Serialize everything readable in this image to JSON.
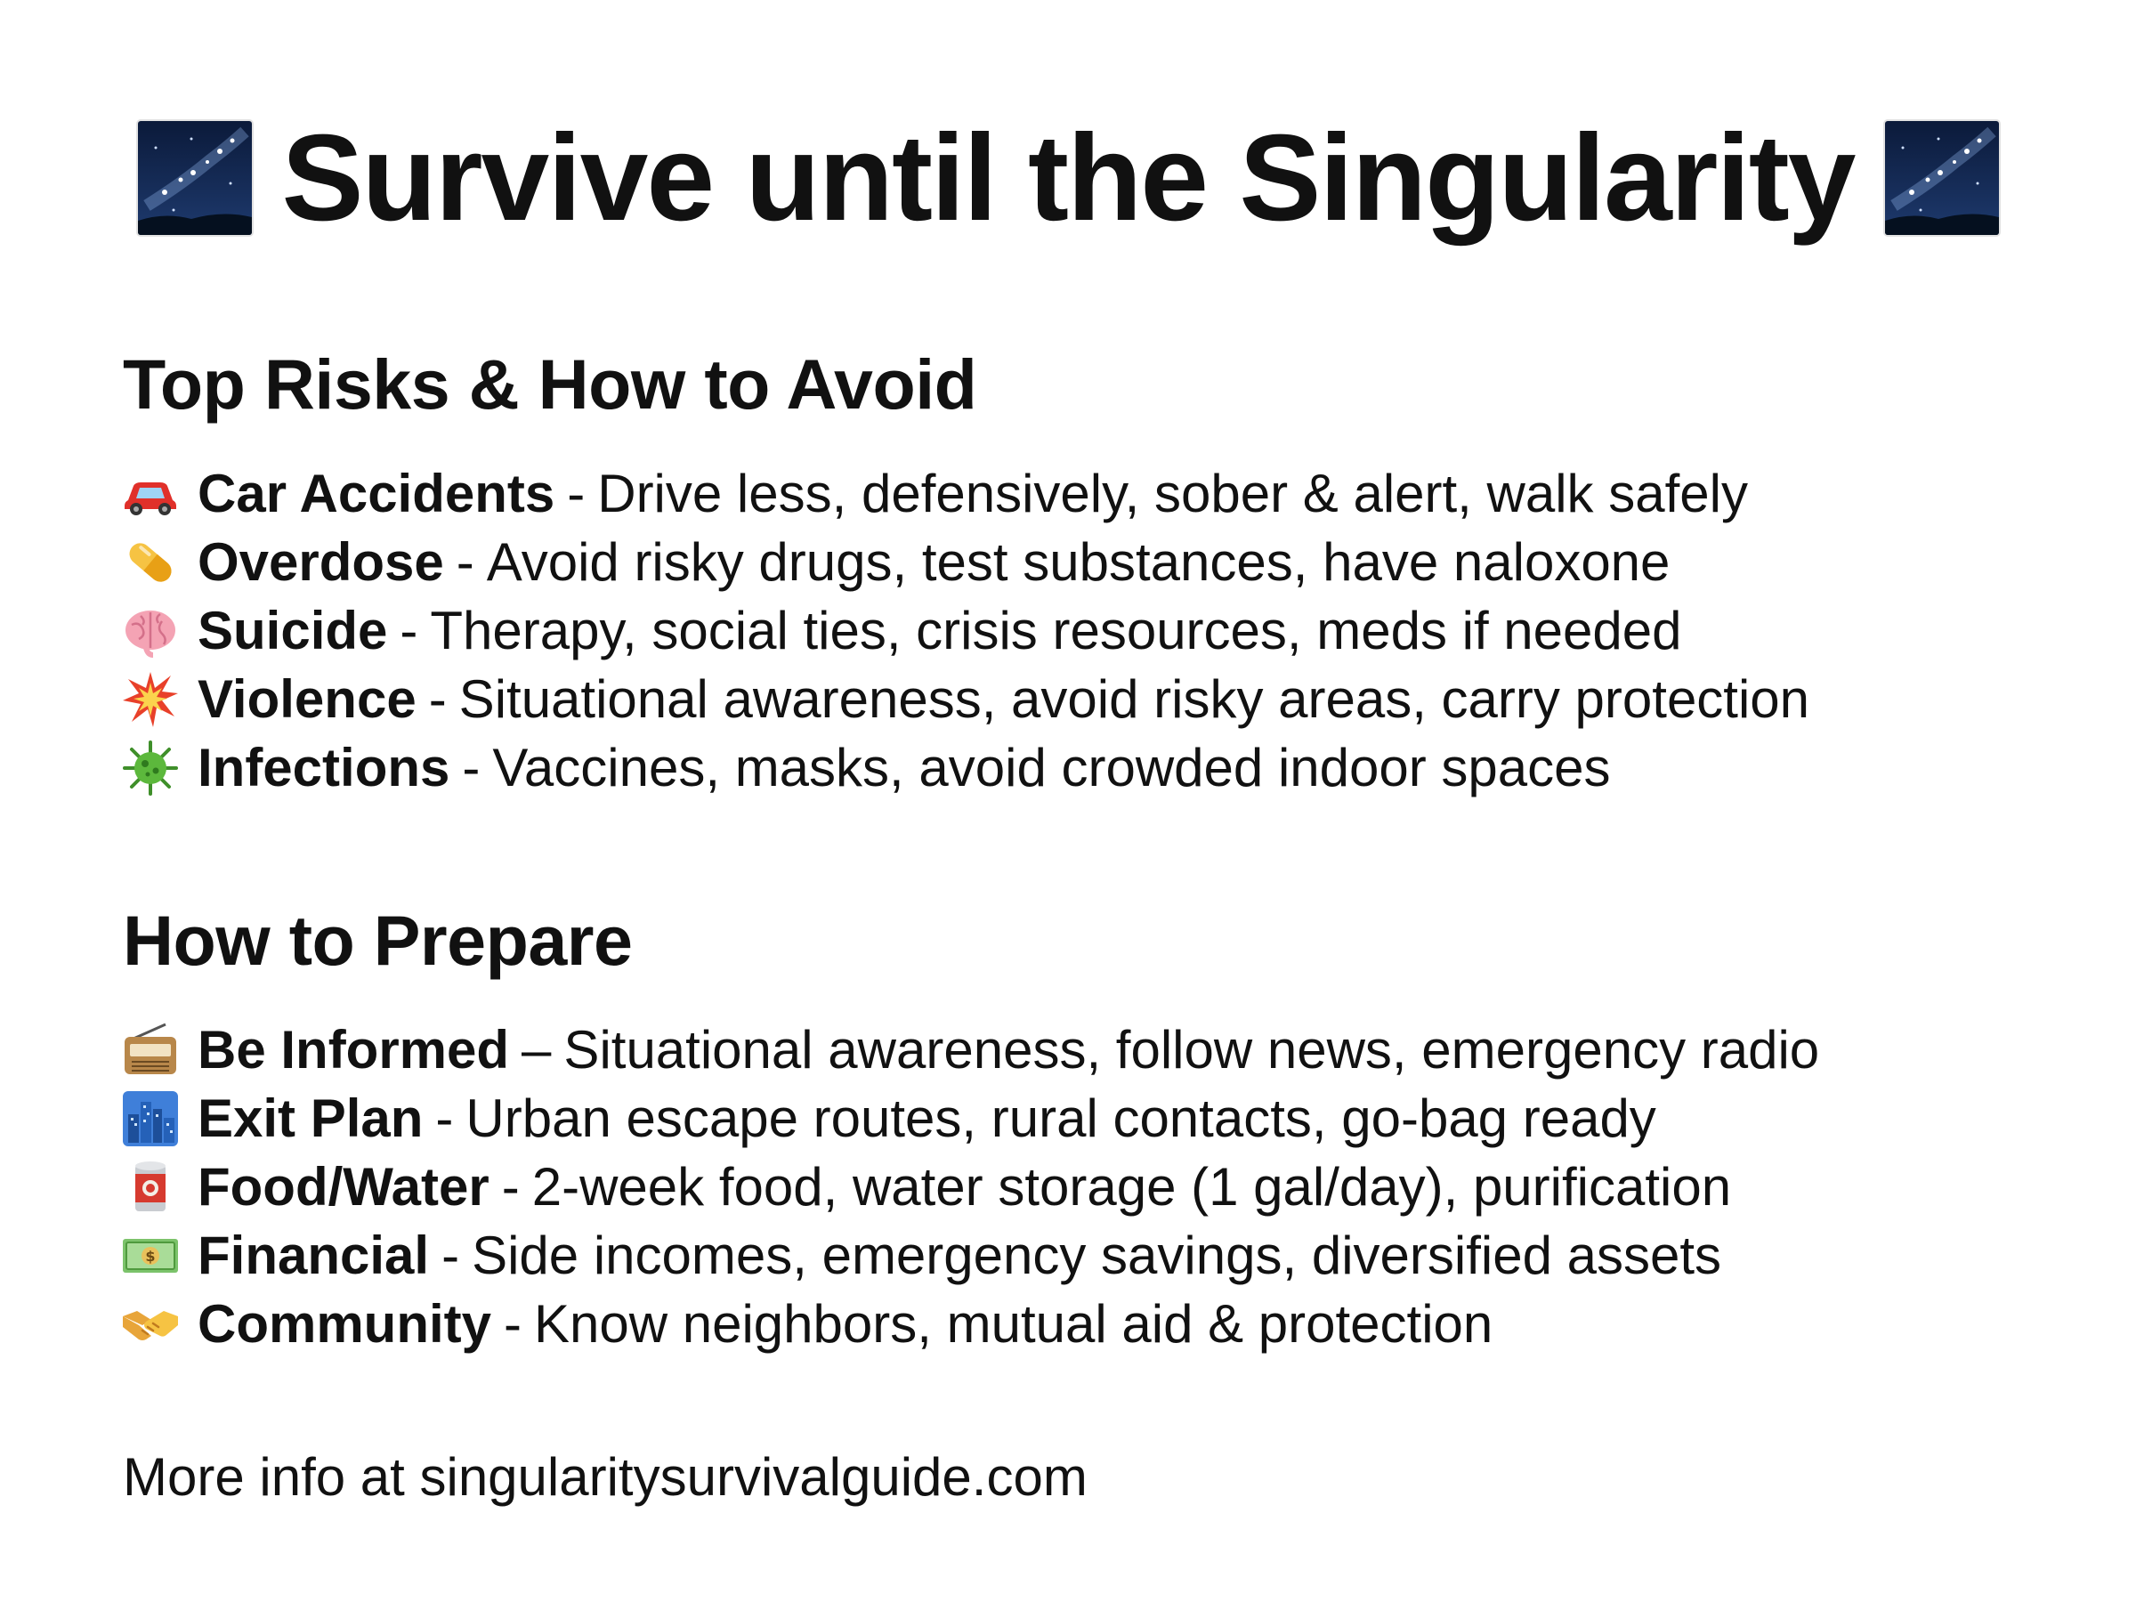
{
  "title": {
    "text": "Survive until the Singularity",
    "icon_left": "milky-way-icon",
    "icon_right": "milky-way-icon"
  },
  "risks": {
    "heading": "Top Risks & How to Avoid",
    "items": [
      {
        "icon": "car-icon",
        "name": "Car Accidents",
        "sep": "-",
        "desc": "Drive less, defensively, sober & alert, walk safely"
      },
      {
        "icon": "pill-icon",
        "name": "Overdose",
        "sep": "-",
        "desc": "Avoid risky drugs, test substances, have naloxone"
      },
      {
        "icon": "brain-icon",
        "name": "Suicide",
        "sep": "-",
        "desc": "Therapy, social ties, crisis resources, meds if needed"
      },
      {
        "icon": "collision-icon",
        "name": "Violence",
        "sep": "-",
        "desc": "Situational awareness, avoid risky areas, carry protection"
      },
      {
        "icon": "microbe-icon",
        "name": "Infections",
        "sep": "-",
        "desc": "Vaccines, masks, avoid crowded indoor spaces"
      }
    ]
  },
  "prepare": {
    "heading": "How to Prepare",
    "items": [
      {
        "icon": "radio-icon",
        "name": "Be Informed",
        "sep": "–",
        "desc": "Situational awareness, follow news, emergency radio"
      },
      {
        "icon": "cityscape-icon",
        "name": "Exit Plan",
        "sep": "-",
        "desc": "Urban escape routes, rural contacts, go-bag ready"
      },
      {
        "icon": "canned-food-icon",
        "name": "Food/Water",
        "sep": "-",
        "desc": "2-week food, water storage (1 gal/day), purification"
      },
      {
        "icon": "money-icon",
        "name": "Financial",
        "sep": "-",
        "desc": "Side incomes, emergency savings, diversified assets"
      },
      {
        "icon": "handshake-icon",
        "name": "Community",
        "sep": "-",
        "desc": "Know neighbors, mutual aid & protection"
      }
    ]
  },
  "footer": {
    "text": "More info at singularitysurvivalguide.com"
  },
  "colors": {
    "text": "#111111",
    "background": "#ffffff"
  }
}
